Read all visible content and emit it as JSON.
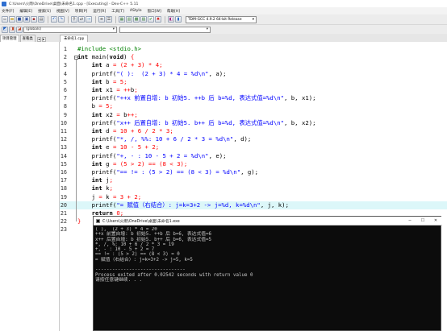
{
  "window": {
    "title": "C:\\Users\\火雨\\OneDrive\\桌面\\未命名1.cpp - [Executing] - Dev-C++ 5.11"
  },
  "menu": [
    "文件[F]",
    "编辑[E]",
    "搜索[S]",
    "视图[V]",
    "项目[P]",
    "运行[R]",
    "工具[T]",
    "AStyle",
    "窗口[W]",
    "帮助[H]"
  ],
  "toolbar": {
    "compiler": "TDM-GCC 4.9.2 64-bit Release"
  },
  "toolbar2": {
    "scope_combo": "(globals)",
    "func_combo": ""
  },
  "panel": {
    "tabs": [
      "项目管理",
      "查看类"
    ]
  },
  "editor": {
    "tab": "未命名1.cpp",
    "highlighted_line": 20,
    "lines": [
      [
        [
          "pp",
          "#include <stdio.h>"
        ]
      ],
      [
        [
          "ty",
          "int"
        ],
        [
          "plain",
          " main("
        ],
        [
          "ty",
          "void"
        ],
        [
          "plain",
          ") "
        ],
        [
          "op",
          "{"
        ]
      ],
      [
        [
          "plain",
          "    "
        ],
        [
          "ty",
          "int"
        ],
        [
          "plain",
          " a "
        ],
        [
          "op",
          "= ("
        ],
        [
          "num",
          "2"
        ],
        [
          "op",
          " + "
        ],
        [
          "num",
          "3"
        ],
        [
          "op",
          ") * "
        ],
        [
          "num",
          "4"
        ],
        [
          "op",
          ";"
        ]
      ],
      [
        [
          "plain",
          "    printf("
        ],
        [
          "str",
          "\"( ):  (2 + 3) * 4 = %d\\n\""
        ],
        [
          "plain",
          ", a);"
        ]
      ],
      [
        [
          "plain",
          "    "
        ],
        [
          "ty",
          "int"
        ],
        [
          "plain",
          " b "
        ],
        [
          "op",
          "= "
        ],
        [
          "num",
          "5"
        ],
        [
          "op",
          ";"
        ]
      ],
      [
        [
          "plain",
          "    "
        ],
        [
          "ty",
          "int"
        ],
        [
          "plain",
          " x1 "
        ],
        [
          "op",
          "= ++"
        ],
        [
          "plain",
          "b"
        ],
        [
          "op",
          ";"
        ]
      ],
      [
        [
          "plain",
          "    printf("
        ],
        [
          "str",
          "\"++x 前置自增: b 初始5. ++b 后 b=%d, 表达式值=%d\\n\""
        ],
        [
          "plain",
          ", b, x1);"
        ]
      ],
      [
        [
          "plain",
          "    b "
        ],
        [
          "op",
          "= "
        ],
        [
          "num",
          "5"
        ],
        [
          "op",
          ";"
        ]
      ],
      [
        [
          "plain",
          "    "
        ],
        [
          "ty",
          "int"
        ],
        [
          "plain",
          " x2 "
        ],
        [
          "op",
          "= "
        ],
        [
          "plain",
          "b"
        ],
        [
          "op",
          "++;"
        ]
      ],
      [
        [
          "plain",
          "    printf("
        ],
        [
          "str",
          "\"x++ 后置自增: b 初始5. b++ 后 b=%d, 表达式值=%d\\n\""
        ],
        [
          "plain",
          ", b, x2);"
        ]
      ],
      [
        [
          "plain",
          "    "
        ],
        [
          "ty",
          "int"
        ],
        [
          "plain",
          " d "
        ],
        [
          "op",
          "= "
        ],
        [
          "num",
          "10"
        ],
        [
          "op",
          " + "
        ],
        [
          "num",
          "6"
        ],
        [
          "op",
          " / "
        ],
        [
          "num",
          "2"
        ],
        [
          "op",
          " * "
        ],
        [
          "num",
          "3"
        ],
        [
          "op",
          ";"
        ]
      ],
      [
        [
          "plain",
          "    printf("
        ],
        [
          "str",
          "\"*, /, %%: 10 + 6 / 2 * 3 = %d\\n\""
        ],
        [
          "plain",
          ", d);"
        ]
      ],
      [
        [
          "plain",
          "    "
        ],
        [
          "ty",
          "int"
        ],
        [
          "plain",
          " e "
        ],
        [
          "op",
          "= "
        ],
        [
          "num",
          "10"
        ],
        [
          "op",
          " - "
        ],
        [
          "num",
          "5"
        ],
        [
          "op",
          " + "
        ],
        [
          "num",
          "2"
        ],
        [
          "op",
          ";"
        ]
      ],
      [
        [
          "plain",
          "    printf("
        ],
        [
          "str",
          "\"+, - : 10 - 5 + 2 = %d\\n\""
        ],
        [
          "plain",
          ", e);"
        ]
      ],
      [
        [
          "plain",
          "    "
        ],
        [
          "ty",
          "int"
        ],
        [
          "plain",
          " g "
        ],
        [
          "op",
          "= ("
        ],
        [
          "num",
          "5"
        ],
        [
          "op",
          " > "
        ],
        [
          "num",
          "2"
        ],
        [
          "op",
          ") == ("
        ],
        [
          "num",
          "8"
        ],
        [
          "op",
          " < "
        ],
        [
          "num",
          "3"
        ],
        [
          "op",
          ");"
        ]
      ],
      [
        [
          "plain",
          "    printf("
        ],
        [
          "str",
          "\"== != : (5 > 2) == (8 < 3) = %d\\n\""
        ],
        [
          "plain",
          ", g);"
        ]
      ],
      [
        [
          "plain",
          "    "
        ],
        [
          "ty",
          "int"
        ],
        [
          "plain",
          " j"
        ],
        [
          "op",
          ";"
        ]
      ],
      [
        [
          "plain",
          "    "
        ],
        [
          "ty",
          "int"
        ],
        [
          "plain",
          " k"
        ],
        [
          "op",
          ";"
        ]
      ],
      [
        [
          "plain",
          "    j "
        ],
        [
          "op",
          "= "
        ],
        [
          "plain",
          "k "
        ],
        [
          "op",
          "= "
        ],
        [
          "num",
          "3"
        ],
        [
          "op",
          " + "
        ],
        [
          "num",
          "2"
        ],
        [
          "op",
          ";"
        ]
      ],
      [
        [
          "plain",
          "    printf("
        ],
        [
          "str",
          "\"= 赋值（右结合）: j=k=3+2 -> j=%d, k=%d\\n\""
        ],
        [
          "plain",
          ", j, k);"
        ]
      ],
      [
        [
          "plain",
          "    "
        ],
        [
          "ty",
          "return"
        ],
        [
          "plain",
          " "
        ],
        [
          "num",
          "0"
        ],
        [
          "op",
          ";"
        ]
      ],
      [
        [
          "op",
          "}"
        ]
      ],
      []
    ]
  },
  "console": {
    "title": "C:\\Users\\火雨\\OneDrive\\桌面\\未命名1.exe",
    "output": [
      "( ),  (2 + 3) * 4 = 20",
      "++x 前置自增: b 初始5. ++b 后 b=6, 表达式值=6",
      "x++ 后置自增: b 初始5. b++ 后 b=6, 表达式值=5",
      "*, /, %: 10 + 6 / 2 * 3 = 19",
      "+, - : 10 - 5 + 2 = 7",
      "== != : (5 > 2) == (8 < 3) = 0",
      "= 赋值（右结合）: j=k=3+2 -> j=5, k=5",
      "",
      "--------------------------------",
      "Process exited after 0.02542 seconds with return value 0",
      "请按任意键继续. . ."
    ]
  }
}
